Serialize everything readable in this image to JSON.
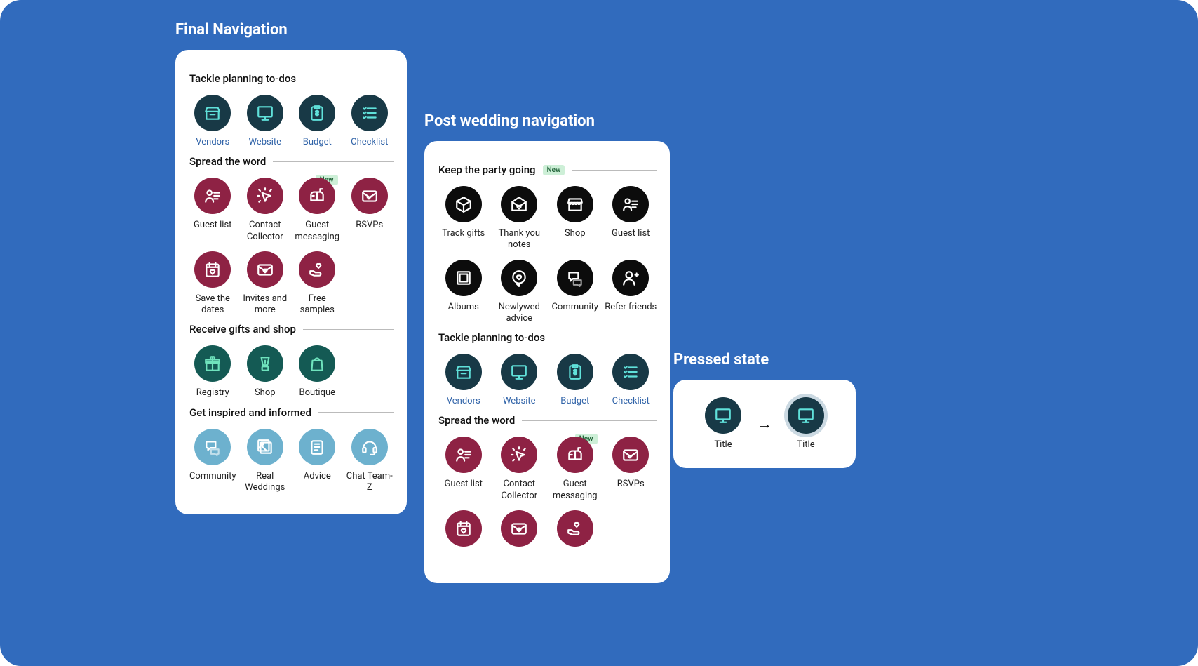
{
  "badges": {
    "new": "New"
  },
  "final": {
    "title": "Final Navigation",
    "sections": [
      {
        "header": "Tackle planning to-dos",
        "color": "c-dblue",
        "link_style": true,
        "items": [
          {
            "label": "Vendors",
            "icon": "store-icon"
          },
          {
            "label": "Website",
            "icon": "monitor-icon"
          },
          {
            "label": "Budget",
            "icon": "money-clipboard-icon"
          },
          {
            "label": "Checklist",
            "icon": "checklist-icon"
          }
        ]
      },
      {
        "header": "Spread the word",
        "color": "c-maroon",
        "items": [
          {
            "label": "Guest list",
            "icon": "guest-list-icon"
          },
          {
            "label": "Contact Collector",
            "icon": "cursor-click-icon"
          },
          {
            "label": "Guest messaging",
            "icon": "mailbox-icon",
            "badge": "new"
          },
          {
            "label": "RSVPs",
            "icon": "envelope-check-icon"
          },
          {
            "label": "Save the dates",
            "icon": "calendar-heart-icon"
          },
          {
            "label": "Invites and more",
            "icon": "envelope-heart-icon"
          },
          {
            "label": "Free samples",
            "icon": "hand-heart-icon"
          }
        ]
      },
      {
        "header": "Receive gifts and shop",
        "color": "c-green",
        "items": [
          {
            "label": "Registry",
            "icon": "gift-icon"
          },
          {
            "label": "Shop",
            "icon": "blender-icon"
          },
          {
            "label": "Boutique",
            "icon": "shopping-bag-icon"
          }
        ]
      },
      {
        "header": "Get inspired and informed",
        "color": "c-sky",
        "items": [
          {
            "label": "Community",
            "icon": "chat-bubbles-icon"
          },
          {
            "label": "Real Weddings",
            "icon": "photos-icon"
          },
          {
            "label": "Advice",
            "icon": "book-icon"
          },
          {
            "label": "Chat Team-Z",
            "icon": "headset-icon"
          }
        ]
      }
    ]
  },
  "post": {
    "title": "Post wedding navigation",
    "sections": [
      {
        "header": "Keep the party going",
        "header_badge": "new",
        "color": "c-black",
        "items": [
          {
            "label": "Track gifts",
            "icon": "package-icon"
          },
          {
            "label": "Thank you notes",
            "icon": "envelope-heart-open-icon"
          },
          {
            "label": "Shop",
            "icon": "store-front-icon"
          },
          {
            "label": "Guest list",
            "icon": "guest-list-icon"
          },
          {
            "label": "Albums",
            "icon": "album-icon"
          },
          {
            "label": "Newlywed advice",
            "icon": "heart-speech-icon"
          },
          {
            "label": "Community",
            "icon": "chat-bubbles-icon"
          },
          {
            "label": "Refer friends",
            "icon": "person-plus-icon"
          }
        ]
      },
      {
        "header": "Tackle planning to-dos",
        "color": "c-dblue",
        "link_style": true,
        "items": [
          {
            "label": "Vendors",
            "icon": "store-icon"
          },
          {
            "label": "Website",
            "icon": "monitor-icon"
          },
          {
            "label": "Budget",
            "icon": "money-clipboard-icon"
          },
          {
            "label": "Checklist",
            "icon": "checklist-icon"
          }
        ]
      },
      {
        "header": "Spread the word",
        "color": "c-maroon",
        "items": [
          {
            "label": "Guest list",
            "icon": "guest-list-icon"
          },
          {
            "label": "Contact Collector",
            "icon": "cursor-click-icon"
          },
          {
            "label": "Guest messaging",
            "icon": "mailbox-icon",
            "badge": "new"
          },
          {
            "label": "RSVPs",
            "icon": "envelope-check-icon"
          },
          {
            "label": "",
            "icon": "calendar-heart-icon"
          },
          {
            "label": "",
            "icon": "envelope-heart-icon"
          },
          {
            "label": "",
            "icon": "hand-heart-icon"
          }
        ]
      }
    ]
  },
  "pressed": {
    "title": "Pressed state",
    "normal_label": "Title",
    "pressed_label": "Title"
  }
}
